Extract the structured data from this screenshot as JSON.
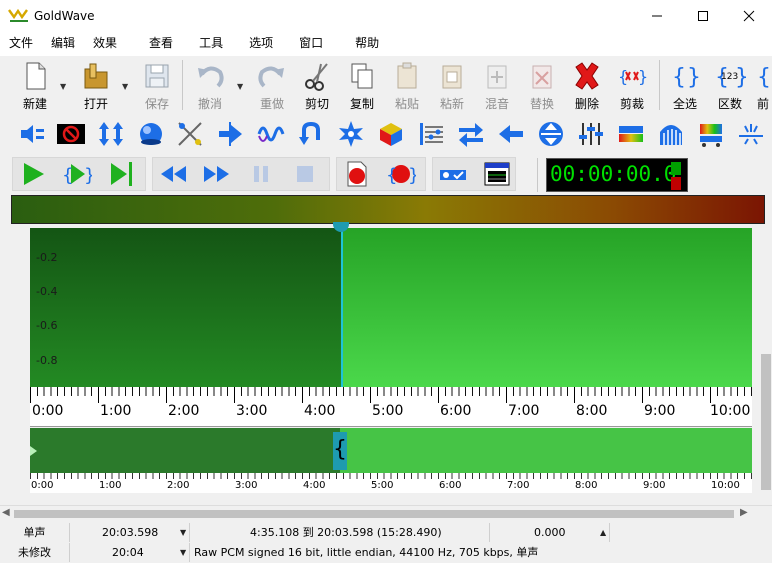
{
  "window": {
    "title": "GoldWave"
  },
  "menu": [
    "文件",
    "编辑",
    "效果",
    "查看",
    "工具",
    "选项",
    "窗口",
    "帮助"
  ],
  "toolbar": {
    "new": "新建",
    "open": "打开",
    "save": "保存",
    "undo": "撤消",
    "redo": "重做",
    "cut": "剪切",
    "copy": "复制",
    "paste": "粘贴",
    "paste_new": "粘新",
    "mix": "混音",
    "replace": "替换",
    "delete": "删除",
    "trim": "剪裁",
    "select_all": "全选",
    "set": "区数",
    "prev": "前"
  },
  "timer": {
    "value": "00:00:00.0"
  },
  "wave": {
    "y_labels": [
      "-0.2",
      "-0.4",
      "-0.6",
      "-0.8"
    ],
    "ruler_labels": [
      "0:00",
      "1:00",
      "2:00",
      "3:00",
      "4:00",
      "5:00",
      "6:00",
      "7:00",
      "8:00",
      "9:00",
      "10:00"
    ],
    "overview_labels": [
      "0:00",
      "1:00",
      "2:00",
      "3:00",
      "4:00",
      "5:00",
      "6:00",
      "7:00",
      "8:00",
      "9:00",
      "10:00"
    ]
  },
  "status": {
    "row1": {
      "channel": "单声",
      "length": "20:03.598",
      "selection": "4:35.108 到 20:03.598 (15:28.490)",
      "position": "0.000"
    },
    "row2": {
      "modified": "未修改",
      "duration": "20:04",
      "format": "Raw PCM signed 16 bit, little endian, 44100 Hz, 705 kbps, 单声"
    }
  },
  "colors": {
    "play_green": "#1fb11f",
    "accent_blue": "#1d6ee6",
    "record_red": "#e01010",
    "wave_selected": "#1d6e1d",
    "wave_unselected": "#3cc83c",
    "cursor": "#1ec3d8"
  }
}
